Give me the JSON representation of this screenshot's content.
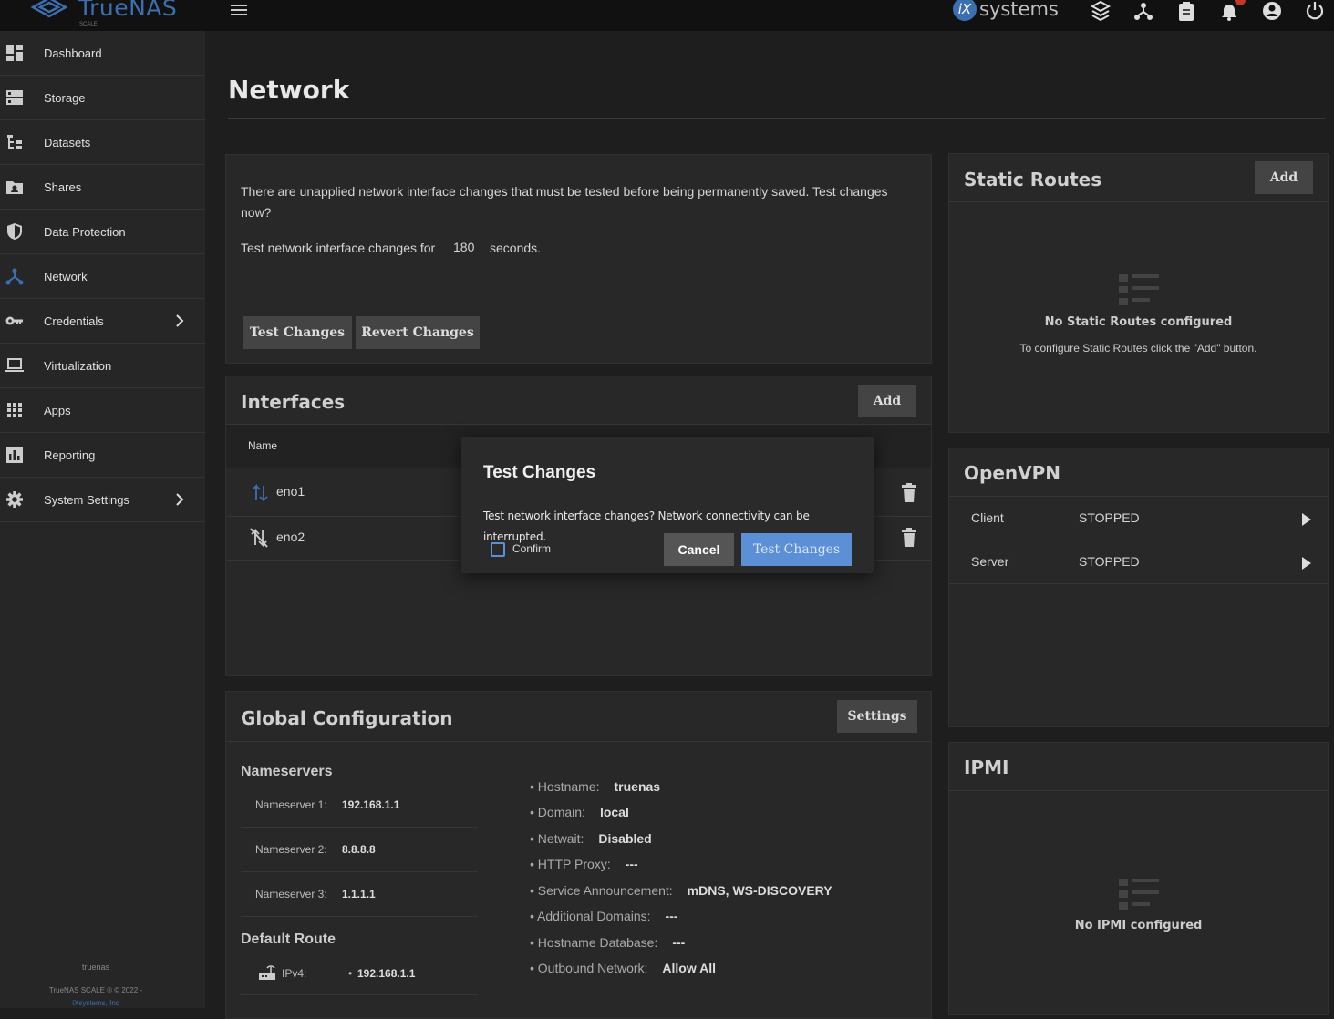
{
  "app": {
    "logo_text": "TrueNAS",
    "logo_sub": "SCALE",
    "vendor_text": "systems",
    "vendor_mark": "iX"
  },
  "sidebar": {
    "items": [
      {
        "label": "Dashboard"
      },
      {
        "label": "Storage"
      },
      {
        "label": "Datasets"
      },
      {
        "label": "Shares"
      },
      {
        "label": "Data Protection"
      },
      {
        "label": "Network"
      },
      {
        "label": "Credentials"
      },
      {
        "label": "Virtualization"
      },
      {
        "label": "Apps"
      },
      {
        "label": "Reporting"
      },
      {
        "label": "System Settings"
      }
    ],
    "hostname": "truenas",
    "copyright": "TrueNAS SCALE ® © 2022 -",
    "company": "iXsystems, Inc"
  },
  "page": {
    "title": "Network"
  },
  "pending": {
    "message": "There are unapplied network interface changes that must be tested before being permanently saved. Test changes now?",
    "test_for_label": "Test network interface changes for",
    "seconds_value": "180",
    "seconds_label": "seconds.",
    "test_button": "Test Changes",
    "revert_button": "Revert Changes"
  },
  "interfaces": {
    "title": "Interfaces",
    "add_button": "Add",
    "column_name": "Name",
    "rows": [
      {
        "name": "eno1"
      },
      {
        "name": "eno2"
      }
    ]
  },
  "global_config": {
    "title": "Global Configuration",
    "settings_button": "Settings",
    "nameservers_title": "Nameservers",
    "nameservers": [
      {
        "label": "Nameserver 1:",
        "value": "192.168.1.1"
      },
      {
        "label": "Nameserver 2:",
        "value": "8.8.8.8"
      },
      {
        "label": "Nameserver 3:",
        "value": "1.1.1.1"
      }
    ],
    "default_route_title": "Default Route",
    "ipv4_label": "IPv4:",
    "ipv4_value": "192.168.1.1",
    "details": [
      {
        "label": "Hostname:",
        "value": "truenas"
      },
      {
        "label": "Domain:",
        "value": "local"
      },
      {
        "label": "Netwait:",
        "value": "Disabled"
      },
      {
        "label": "HTTP Proxy:",
        "value": "---"
      },
      {
        "label": "Service Announcement:",
        "value": "mDNS, WS-DISCOVERY"
      },
      {
        "label": "Additional Domains:",
        "value": "---"
      },
      {
        "label": "Hostname Database:",
        "value": "---"
      },
      {
        "label": "Outbound Network:",
        "value": "Allow All"
      }
    ]
  },
  "static_routes": {
    "title": "Static Routes",
    "add_button": "Add",
    "empty_title": "No Static Routes configured",
    "empty_hint": "To configure Static Routes click the \"Add\" button."
  },
  "openvpn": {
    "title": "OpenVPN",
    "rows": [
      {
        "name": "Client",
        "status": "STOPPED"
      },
      {
        "name": "Server",
        "status": "STOPPED"
      }
    ]
  },
  "ipmi": {
    "title": "IPMI",
    "empty_title": "No IPMI configured"
  },
  "dialog": {
    "title": "Test Changes",
    "message": "Test network interface changes? Network connectivity can be interrupted.",
    "confirm_label": "Confirm",
    "cancel_button": "Cancel",
    "ok_button": "Test Changes"
  },
  "colors": {
    "accent": "#3c6fb0",
    "primary_button": "#5b8fd6",
    "badge": "#c0392b"
  }
}
